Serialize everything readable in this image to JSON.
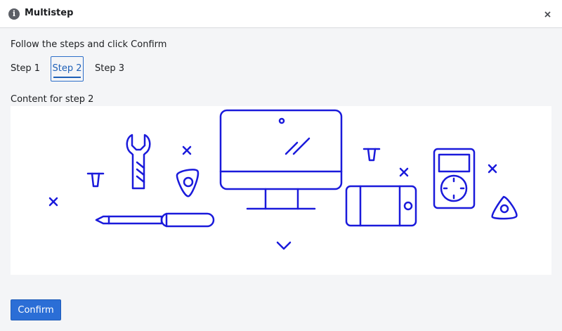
{
  "window": {
    "title": "Multistep",
    "info_icon": "info-icon",
    "close_icon": "close-icon"
  },
  "instruction": "Follow the steps and click Confirm",
  "steps": [
    {
      "label": "Step 1",
      "active": false
    },
    {
      "label": "Step 2",
      "active": true
    },
    {
      "label": "Step 3",
      "active": false
    }
  ],
  "content": {
    "label": "Content for step 2",
    "illustration_icons": [
      "x-mark-icon",
      "pin-icon",
      "wrench-icon",
      "x-mark-icon",
      "guitar-pick-icon",
      "screwdriver-icon",
      "monitor-icon",
      "chevron-down-icon",
      "pin-icon",
      "x-mark-icon",
      "phone-icon",
      "music-player-icon",
      "x-mark-icon",
      "guitar-pick-icon",
      "x-mark-icon"
    ],
    "illustration_color": "#1a1adb"
  },
  "footer": {
    "confirm_label": "Confirm"
  },
  "colors": {
    "accent": "#2b6ed6",
    "active_tab": "#1d5fb7",
    "background": "#f4f5f7"
  }
}
